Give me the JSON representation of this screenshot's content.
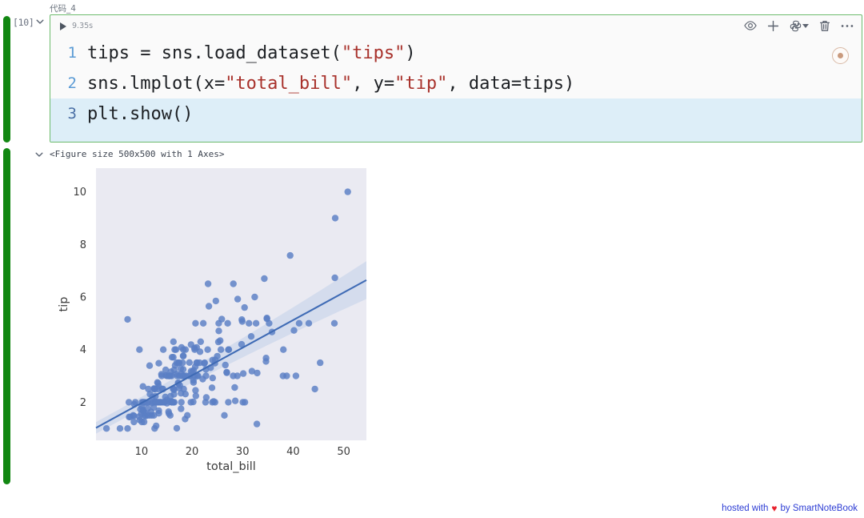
{
  "notebook": {
    "cell_name": "代码_4",
    "execution_count": "[10]",
    "run_time": "9.35s",
    "collapse_icon": "chevron-down-icon"
  },
  "toolbar": {
    "visibility_icon": "eye-icon",
    "add_icon": "plus-icon",
    "kernel_icon": "python-kernel-icon",
    "kernel_chevron_icon": "chevron-down-icon",
    "delete_icon": "trash-icon",
    "more_icon": "ellipsis-icon",
    "kernel_status_icon": "kernel-status-icon"
  },
  "code": {
    "lines": [
      {
        "number": "1",
        "highlighted": false,
        "tokens": [
          {
            "t": "tips = sns.load_dataset(",
            "k": "plain"
          },
          {
            "t": "\"tips\"",
            "k": "str"
          },
          {
            "t": ")",
            "k": "plain"
          }
        ]
      },
      {
        "number": "2",
        "highlighted": false,
        "tokens": [
          {
            "t": "sns.lmplot(x=",
            "k": "plain"
          },
          {
            "t": "\"total_bill\"",
            "k": "str"
          },
          {
            "t": ", y=",
            "k": "plain"
          },
          {
            "t": "\"tip\"",
            "k": "str"
          },
          {
            "t": ", data=tips)",
            "k": "plain"
          }
        ]
      },
      {
        "number": "3",
        "highlighted": true,
        "tokens": [
          {
            "t": "plt.show()",
            "k": "plain"
          }
        ]
      }
    ]
  },
  "output": {
    "collapse_icon": "chevron-down-icon",
    "figure_repr": "<Figure size 500x500 with 1 Axes>"
  },
  "footer": {
    "prefix": "hosted with",
    "heart": "♥",
    "suffix": "by SmartNoteBook"
  },
  "colors": {
    "cell_border": "#6dbb6d",
    "gutter_green": "#128712",
    "string_red": "#a8312b",
    "line_number_blue": "#5b9bd5",
    "highlight_blue": "#ddeef8",
    "plot_bg": "#eaeaf2",
    "point_blue": "#5a7fc4",
    "line_blue": "#3f6bb5",
    "band_blue": "#c6d3ea",
    "footer_blue": "#2b3bd4",
    "heart_red": "#e8212c"
  },
  "chart_data": {
    "type": "scatter",
    "title": "",
    "xlabel": "total_bill",
    "ylabel": "tip",
    "xlim": [
      1.0,
      54.5
    ],
    "ylim": [
      0.55,
      10.9
    ],
    "xticks": [
      10,
      20,
      30,
      40,
      50
    ],
    "yticks": [
      2,
      4,
      6,
      8,
      10
    ],
    "grid": false,
    "legend": null,
    "regression": {
      "type": "linear",
      "slope": 0.105,
      "intercept": 0.92,
      "ci": 95,
      "ci_halfwidth_at_min": 0.22,
      "ci_halfwidth_at_max": 0.72
    },
    "points": [
      [
        16.99,
        1.01
      ],
      [
        10.34,
        1.66
      ],
      [
        21.01,
        3.5
      ],
      [
        23.68,
        3.31
      ],
      [
        24.59,
        3.61
      ],
      [
        25.29,
        4.71
      ],
      [
        8.77,
        2.0
      ],
      [
        26.88,
        3.12
      ],
      [
        15.04,
        1.96
      ],
      [
        14.78,
        3.23
      ],
      [
        10.27,
        1.71
      ],
      [
        35.26,
        5.0
      ],
      [
        15.42,
        1.57
      ],
      [
        18.43,
        3.0
      ],
      [
        14.83,
        3.02
      ],
      [
        21.58,
        3.92
      ],
      [
        10.33,
        1.67
      ],
      [
        16.29,
        3.71
      ],
      [
        16.97,
        3.5
      ],
      [
        20.65,
        3.35
      ],
      [
        17.92,
        4.08
      ],
      [
        20.29,
        2.75
      ],
      [
        15.77,
        2.23
      ],
      [
        39.42,
        7.58
      ],
      [
        19.82,
        3.18
      ],
      [
        17.81,
        2.34
      ],
      [
        13.37,
        2.0
      ],
      [
        12.69,
        2.0
      ],
      [
        21.7,
        4.3
      ],
      [
        19.65,
        3.0
      ],
      [
        9.55,
        1.45
      ],
      [
        18.35,
        2.5
      ],
      [
        15.06,
        3.0
      ],
      [
        20.69,
        2.45
      ],
      [
        17.78,
        3.27
      ],
      [
        24.06,
        3.6
      ],
      [
        16.31,
        2.0
      ],
      [
        16.93,
        3.07
      ],
      [
        18.69,
        2.31
      ],
      [
        31.27,
        5.0
      ],
      [
        16.04,
        3.71
      ],
      [
        17.46,
        2.54
      ],
      [
        13.94,
        3.06
      ],
      [
        9.68,
        1.32
      ],
      [
        30.4,
        5.6
      ],
      [
        18.29,
        3.0
      ],
      [
        22.23,
        5.0
      ],
      [
        32.4,
        6.0
      ],
      [
        28.55,
        2.05
      ],
      [
        18.04,
        3.0
      ],
      [
        12.54,
        2.5
      ],
      [
        10.29,
        2.6
      ],
      [
        34.81,
        5.2
      ],
      [
        9.94,
        1.56
      ],
      [
        25.56,
        4.34
      ],
      [
        19.49,
        3.51
      ],
      [
        38.01,
        3.0
      ],
      [
        26.41,
        1.5
      ],
      [
        11.24,
        1.76
      ],
      [
        48.27,
        6.73
      ],
      [
        20.29,
        3.21
      ],
      [
        13.81,
        2.0
      ],
      [
        11.02,
        1.98
      ],
      [
        18.29,
        3.76
      ],
      [
        17.59,
        2.64
      ],
      [
        20.08,
        3.15
      ],
      [
        16.45,
        2.47
      ],
      [
        3.07,
        1.0
      ],
      [
        20.23,
        2.01
      ],
      [
        15.01,
        2.09
      ],
      [
        12.02,
        1.97
      ],
      [
        17.07,
        3.0
      ],
      [
        26.86,
        3.14
      ],
      [
        25.28,
        5.0
      ],
      [
        14.73,
        2.2
      ],
      [
        10.51,
        1.25
      ],
      [
        17.92,
        3.08
      ],
      [
        27.2,
        4.0
      ],
      [
        22.76,
        3.0
      ],
      [
        17.29,
        2.71
      ],
      [
        19.44,
        3.0
      ],
      [
        16.66,
        3.4
      ],
      [
        10.07,
        1.83
      ],
      [
        32.68,
        5.0
      ],
      [
        15.98,
        2.03
      ],
      [
        34.83,
        5.17
      ],
      [
        13.03,
        2.0
      ],
      [
        18.28,
        4.0
      ],
      [
        24.71,
        5.85
      ],
      [
        21.16,
        3.0
      ],
      [
        28.97,
        3.0
      ],
      [
        22.49,
        3.5
      ],
      [
        5.75,
        1.0
      ],
      [
        16.32,
        4.3
      ],
      [
        22.75,
        3.25
      ],
      [
        40.17,
        4.73
      ],
      [
        27.28,
        4.0
      ],
      [
        12.03,
        1.5
      ],
      [
        21.01,
        3.0
      ],
      [
        12.46,
        1.5
      ],
      [
        11.35,
        2.5
      ],
      [
        15.38,
        3.0
      ],
      [
        44.3,
        2.5
      ],
      [
        22.42,
        3.48
      ],
      [
        20.92,
        4.08
      ],
      [
        15.36,
        1.64
      ],
      [
        20.49,
        4.06
      ],
      [
        25.21,
        4.29
      ],
      [
        18.24,
        3.76
      ],
      [
        14.31,
        4.0
      ],
      [
        14.0,
        3.0
      ],
      [
        7.25,
        1.0
      ],
      [
        38.07,
        4.0
      ],
      [
        23.95,
        2.55
      ],
      [
        25.71,
        4.0
      ],
      [
        17.31,
        3.5
      ],
      [
        29.93,
        5.07
      ],
      [
        10.65,
        1.5
      ],
      [
        12.43,
        1.8
      ],
      [
        24.08,
        2.92
      ],
      [
        11.69,
        2.31
      ],
      [
        13.42,
        1.68
      ],
      [
        14.26,
        2.5
      ],
      [
        15.95,
        2.0
      ],
      [
        12.48,
        2.52
      ],
      [
        29.8,
        4.2
      ],
      [
        8.52,
        1.48
      ],
      [
        14.52,
        2.0
      ],
      [
        11.38,
        2.0
      ],
      [
        22.82,
        2.18
      ],
      [
        19.08,
        1.5
      ],
      [
        20.27,
        2.83
      ],
      [
        11.17,
        1.5
      ],
      [
        12.26,
        2.0
      ],
      [
        18.26,
        3.25
      ],
      [
        8.51,
        1.25
      ],
      [
        10.33,
        2.0
      ],
      [
        14.15,
        2.0
      ],
      [
        16.0,
        2.0
      ],
      [
        13.16,
        2.75
      ],
      [
        17.47,
        3.5
      ],
      [
        34.3,
        6.7
      ],
      [
        41.19,
        5.0
      ],
      [
        27.05,
        5.0
      ],
      [
        16.43,
        2.3
      ],
      [
        8.35,
        1.5
      ],
      [
        18.64,
        1.36
      ],
      [
        11.87,
        1.63
      ],
      [
        9.78,
        1.73
      ],
      [
        7.51,
        2.0
      ],
      [
        14.07,
        2.5
      ],
      [
        13.13,
        2.0
      ],
      [
        17.26,
        2.74
      ],
      [
        24.55,
        2.0
      ],
      [
        19.77,
        2.0
      ],
      [
        29.85,
        5.14
      ],
      [
        48.17,
        5.0
      ],
      [
        25.0,
        3.75
      ],
      [
        13.39,
        2.61
      ],
      [
        16.49,
        2.0
      ],
      [
        21.5,
        3.5
      ],
      [
        12.66,
        2.5
      ],
      [
        16.21,
        2.0
      ],
      [
        13.81,
        2.0
      ],
      [
        17.51,
        3.0
      ],
      [
        24.52,
        3.48
      ],
      [
        20.76,
        2.24
      ],
      [
        31.71,
        4.5
      ],
      [
        10.59,
        1.61
      ],
      [
        10.63,
        2.0
      ],
      [
        50.81,
        10.0
      ],
      [
        15.81,
        3.16
      ],
      [
        7.25,
        5.15
      ],
      [
        31.85,
        3.18
      ],
      [
        16.82,
        4.0
      ],
      [
        32.9,
        3.11
      ],
      [
        17.89,
        2.0
      ],
      [
        14.48,
        2.0
      ],
      [
        9.6,
        4.0
      ],
      [
        34.63,
        3.55
      ],
      [
        34.65,
        3.68
      ],
      [
        23.33,
        5.65
      ],
      [
        45.35,
        3.5
      ],
      [
        23.17,
        6.5
      ],
      [
        40.55,
        3.0
      ],
      [
        20.69,
        5.0
      ],
      [
        20.9,
        3.5
      ],
      [
        30.46,
        2.0
      ],
      [
        18.15,
        3.5
      ],
      [
        23.1,
        4.0
      ],
      [
        15.69,
        1.5
      ],
      [
        19.81,
        4.19
      ],
      [
        28.44,
        2.56
      ],
      [
        15.48,
        2.02
      ],
      [
        16.58,
        4.0
      ],
      [
        7.56,
        1.44
      ],
      [
        10.34,
        2.0
      ],
      [
        43.11,
        5.0
      ],
      [
        13.0,
        2.0
      ],
      [
        13.51,
        2.0
      ],
      [
        18.71,
        4.0
      ],
      [
        12.74,
        2.01
      ],
      [
        13.0,
        2.0
      ],
      [
        16.4,
        2.5
      ],
      [
        20.53,
        4.0
      ],
      [
        16.47,
        3.23
      ],
      [
        26.59,
        3.41
      ],
      [
        38.73,
        3.0
      ],
      [
        24.27,
        2.03
      ],
      [
        12.76,
        2.23
      ],
      [
        30.06,
        2.0
      ],
      [
        25.89,
        5.16
      ],
      [
        48.33,
        9.0
      ],
      [
        13.27,
        2.5
      ],
      [
        28.17,
        6.5
      ],
      [
        12.9,
        1.1
      ],
      [
        28.15,
        3.0
      ],
      [
        11.59,
        1.5
      ],
      [
        7.74,
        1.44
      ],
      [
        30.14,
        3.09
      ],
      [
        12.16,
        2.2
      ],
      [
        13.42,
        3.48
      ],
      [
        8.58,
        1.92
      ],
      [
        15.98,
        3.0
      ],
      [
        13.42,
        1.58
      ],
      [
        16.27,
        2.5
      ],
      [
        10.09,
        2.0
      ],
      [
        20.45,
        3.0
      ],
      [
        13.28,
        2.72
      ],
      [
        22.12,
        2.88
      ],
      [
        24.01,
        2.0
      ],
      [
        15.69,
        3.0
      ],
      [
        11.61,
        3.39
      ],
      [
        10.77,
        1.47
      ],
      [
        15.53,
        3.0
      ],
      [
        10.07,
        1.25
      ],
      [
        12.6,
        1.0
      ],
      [
        32.83,
        1.17
      ],
      [
        35.83,
        4.67
      ],
      [
        29.03,
        5.92
      ],
      [
        27.18,
        2.0
      ],
      [
        22.67,
        2.0
      ],
      [
        17.82,
        1.75
      ],
      [
        18.78,
        3.0
      ]
    ]
  }
}
